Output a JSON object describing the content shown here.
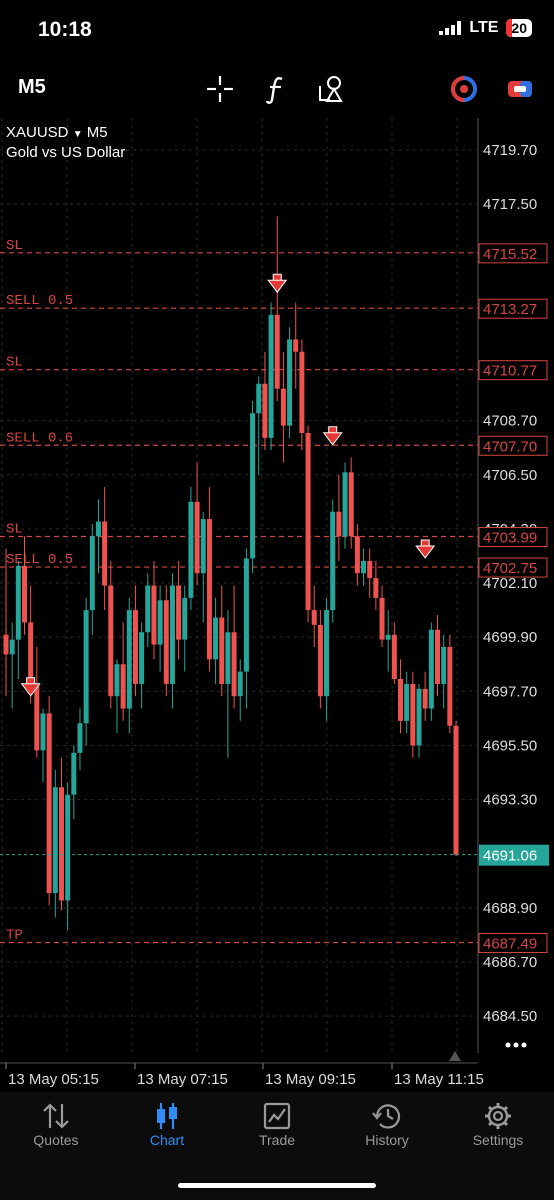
{
  "status": {
    "time": "10:18",
    "network": "LTE",
    "battery": "20"
  },
  "toolbar": {
    "timeframe": "M5"
  },
  "symbol": {
    "name": "XAUUSD",
    "timeframe": "M5",
    "description": "Gold vs US Dollar"
  },
  "colors": {
    "bull": "#26a69a",
    "bear": "#ef5350",
    "grid": "#2a2a2a",
    "trade_line": "#d64541",
    "bid_line": "#26a69a"
  },
  "price_axis": {
    "ticks": [
      "4719.70",
      "4717.50",
      "4708.70",
      "4706.50",
      "4704.30",
      "4702.10",
      "4699.90",
      "4697.70",
      "4695.50",
      "4693.30",
      "4688.90",
      "4686.70",
      "4684.50"
    ],
    "current_price": "4691.06"
  },
  "time_axis": [
    "13 May 05:15",
    "13 May 07:15",
    "13 May 09:15",
    "13 May 11:15"
  ],
  "trade_lines": [
    {
      "label": "SL",
      "price": "4715.52"
    },
    {
      "label": "SELL 0.5",
      "price": "4713.27"
    },
    {
      "label": "SL",
      "price": "4710.77"
    },
    {
      "label": "SELL 0.6",
      "price": "4707.70"
    },
    {
      "label": "SL",
      "price": "4703.99"
    },
    {
      "label": "SELL 0.5",
      "price": "4702.75"
    },
    {
      "label": "TP",
      "price": "4687.49"
    }
  ],
  "icons": [
    "crosshair-icon",
    "indicators-icon",
    "objects-icon",
    "one-click-trading-icon",
    "trade-toggle-icon",
    "more-icon"
  ],
  "tabs": [
    {
      "label": "Quotes",
      "icon": "quotes-icon"
    },
    {
      "label": "Chart",
      "icon": "chart-icon",
      "active": true
    },
    {
      "label": "Trade",
      "icon": "trade-icon"
    },
    {
      "label": "History",
      "icon": "history-icon"
    },
    {
      "label": "Settings",
      "icon": "settings-icon"
    }
  ],
  "chart_data": {
    "type": "candlestick",
    "symbol": "XAUUSD",
    "timeframe": "M5",
    "ylim": [
      4683.0,
      4721.0
    ],
    "x_labels": [
      "13 May 05:15",
      "13 May 07:15",
      "13 May 09:15",
      "13 May 11:15"
    ],
    "candles": [
      [
        4700.0,
        4703.5,
        4697.5,
        4699.2
      ],
      [
        4699.2,
        4700.5,
        4697.0,
        4699.8
      ],
      [
        4699.8,
        4703.0,
        4698.2,
        4702.8
      ],
      [
        4702.8,
        4704.0,
        4700.0,
        4700.5
      ],
      [
        4700.5,
        4702.0,
        4697.2,
        4698.0
      ],
      [
        4698.0,
        4699.5,
        4695.0,
        4695.3
      ],
      [
        4695.3,
        4697.0,
        4694.0,
        4696.8
      ],
      [
        4696.8,
        4697.5,
        4689.0,
        4689.5
      ],
      [
        4689.5,
        4694.5,
        4688.5,
        4693.8
      ],
      [
        4693.8,
        4695.0,
        4688.8,
        4689.2
      ],
      [
        4689.2,
        4694.0,
        4688.0,
        4693.5
      ],
      [
        4693.5,
        4695.5,
        4692.5,
        4695.2
      ],
      [
        4695.2,
        4697.0,
        4694.5,
        4696.4
      ],
      [
        4696.4,
        4701.5,
        4695.5,
        4701.0
      ],
      [
        4701.0,
        4704.5,
        4700.0,
        4704.0
      ],
      [
        4704.0,
        4705.5,
        4702.5,
        4704.6
      ],
      [
        4704.6,
        4706.0,
        4701.0,
        4702.0
      ],
      [
        4702.0,
        4703.0,
        4697.0,
        4697.5
      ],
      [
        4697.5,
        4699.0,
        4696.0,
        4698.8
      ],
      [
        4698.8,
        4700.5,
        4696.5,
        4697.0
      ],
      [
        4697.0,
        4701.5,
        4696.0,
        4701.0
      ],
      [
        4701.0,
        4702.0,
        4697.5,
        4698.0
      ],
      [
        4698.0,
        4700.5,
        4697.0,
        4700.1
      ],
      [
        4700.1,
        4702.5,
        4699.5,
        4702.0
      ],
      [
        4702.0,
        4703.0,
        4699.0,
        4699.6
      ],
      [
        4699.6,
        4702.0,
        4698.5,
        4701.4
      ],
      [
        4701.4,
        4702.0,
        4697.5,
        4698.0
      ],
      [
        4698.0,
        4702.5,
        4697.0,
        4702.0
      ],
      [
        4702.0,
        4703.0,
        4699.0,
        4699.8
      ],
      [
        4699.8,
        4702.0,
        4698.5,
        4701.5
      ],
      [
        4701.5,
        4706.0,
        4701.0,
        4705.4
      ],
      [
        4705.4,
        4707.0,
        4702.0,
        4702.5
      ],
      [
        4702.5,
        4705.0,
        4700.5,
        4704.7
      ],
      [
        4704.7,
        4706.0,
        4698.5,
        4699.0
      ],
      [
        4699.0,
        4701.5,
        4698.0,
        4700.7
      ],
      [
        4700.7,
        4702.0,
        4697.5,
        4698.0
      ],
      [
        4698.0,
        4701.0,
        4695.0,
        4700.1
      ],
      [
        4700.1,
        4702.0,
        4697.0,
        4697.5
      ],
      [
        4697.5,
        4699.0,
        4696.5,
        4698.5
      ],
      [
        4698.5,
        4703.5,
        4697.0,
        4703.1
      ],
      [
        4703.1,
        4709.5,
        4702.5,
        4709.0
      ],
      [
        4709.0,
        4710.5,
        4706.5,
        4710.2
      ],
      [
        4710.2,
        4711.5,
        4707.5,
        4708.0
      ],
      [
        4708.0,
        4713.5,
        4707.5,
        4713.0
      ],
      [
        4713.0,
        4717.0,
        4709.5,
        4710.0
      ],
      [
        4710.0,
        4711.5,
        4707.0,
        4708.5
      ],
      [
        4708.5,
        4712.5,
        4708.0,
        4712.0
      ],
      [
        4712.0,
        4713.5,
        4710.0,
        4711.5
      ],
      [
        4711.5,
        4712.0,
        4707.5,
        4708.2
      ],
      [
        4708.2,
        4708.5,
        4700.5,
        4701.0
      ],
      [
        4701.0,
        4702.0,
        4699.5,
        4700.4
      ],
      [
        4700.4,
        4701.0,
        4697.0,
        4697.5
      ],
      [
        4697.5,
        4701.5,
        4696.5,
        4701.0
      ],
      [
        4701.0,
        4705.5,
        4700.5,
        4705.0
      ],
      [
        4705.0,
        4706.5,
        4703.0,
        4704.0
      ],
      [
        4704.0,
        4707.0,
        4703.5,
        4706.6
      ],
      [
        4706.6,
        4707.2,
        4703.5,
        4704.0
      ],
      [
        4704.0,
        4704.5,
        4702.0,
        4702.5
      ],
      [
        4702.5,
        4703.5,
        4702.0,
        4703.0
      ],
      [
        4703.0,
        4703.5,
        4701.5,
        4702.3
      ],
      [
        4702.3,
        4703.0,
        4701.0,
        4701.5
      ],
      [
        4701.5,
        4702.0,
        4699.5,
        4699.8
      ],
      [
        4699.8,
        4701.0,
        4698.5,
        4700.0
      ],
      [
        4700.0,
        4700.5,
        4698.0,
        4698.2
      ],
      [
        4698.2,
        4699.0,
        4696.0,
        4696.5
      ],
      [
        4696.5,
        4698.5,
        4696.0,
        4698.0
      ],
      [
        4698.0,
        4698.5,
        4695.0,
        4695.5
      ],
      [
        4695.5,
        4698.0,
        4695.0,
        4697.8
      ],
      [
        4697.8,
        4698.5,
        4696.5,
        4697.0
      ],
      [
        4697.0,
        4700.5,
        4696.5,
        4700.2
      ],
      [
        4700.2,
        4700.8,
        4697.5,
        4698.0
      ],
      [
        4698.0,
        4700.0,
        4697.0,
        4699.5
      ],
      [
        4699.5,
        4700.0,
        4696.0,
        4696.3
      ],
      [
        4696.3,
        4696.5,
        4691.0,
        4691.06
      ]
    ]
  }
}
